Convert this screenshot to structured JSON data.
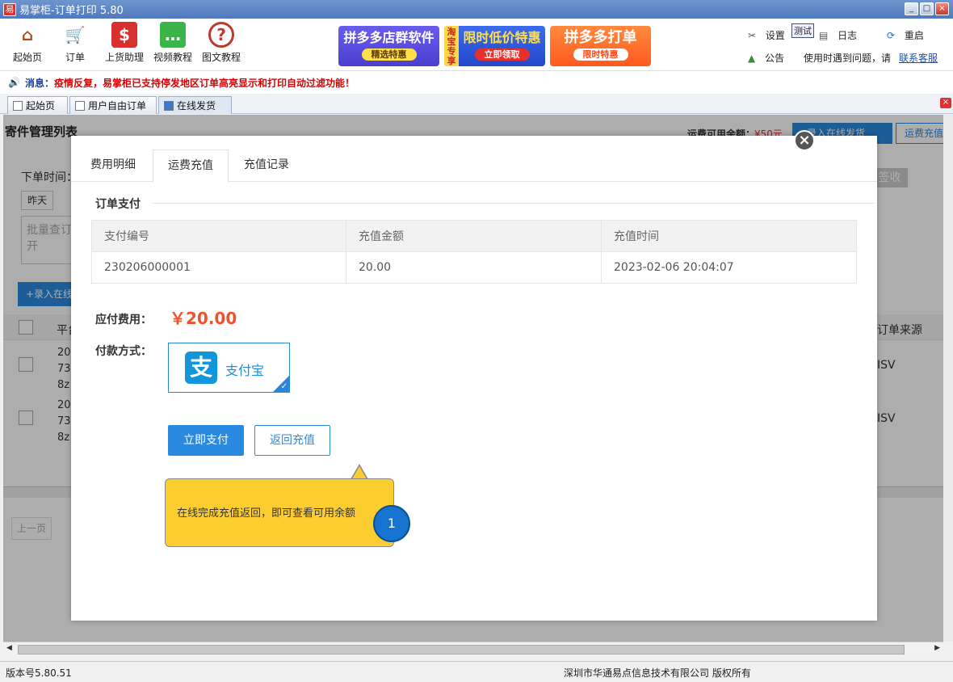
{
  "window": {
    "title": "易掌柜-订单打印 5.80",
    "app_icon": "易"
  },
  "toolbar": {
    "buttons": [
      {
        "label": "起始页",
        "icon": "home-icon"
      },
      {
        "label": "订单",
        "icon": "cart-icon"
      },
      {
        "label": "上货助理",
        "icon": "money-bag-icon"
      },
      {
        "label": "视频教程",
        "icon": "chat-icon"
      },
      {
        "label": "图文教程",
        "icon": "question-icon"
      }
    ],
    "banners": [
      {
        "title": "拼多多店群软件",
        "pill": "精选特惠",
        "color": "#5a4fe0"
      },
      {
        "side": "淘宝专享",
        "title": "限时低价特惠",
        "pill": "立即领取",
        "color": "#2b57e0"
      },
      {
        "title": "拼多多打单",
        "pill": "限时特惠",
        "color": "#ff6a2b"
      }
    ],
    "settings": "设置",
    "test_badge": "测试",
    "log": "日志",
    "restart": "重启",
    "notice": "公告",
    "help_text": "使用时遇到问题，请",
    "contact": "联系客服"
  },
  "message": {
    "prefix": "消息：",
    "text": "疫情反复，易掌柜已支持停发地区订单高亮显示和打印自动过滤功能！"
  },
  "tabs": [
    {
      "label": "起始页"
    },
    {
      "label": "用户自由订单"
    },
    {
      "label": "在线发货"
    }
  ],
  "background": {
    "page_title": "寄件管理列表",
    "balance_label": "运费可用余额：",
    "balance_value": "¥50元",
    "add_button": "+录入在线发货",
    "recharge_button": "运费充值",
    "order_time_label": "下单时间：",
    "yesterday": "昨天",
    "batch_placeholder": "批量查订",
    "batch_more": "开",
    "add_online": "+录入在线",
    "platform_col": "平台",
    "source_col": "订单来源",
    "row1_lines": [
      "20",
      "73",
      "8z"
    ],
    "row2_lines": [
      "20",
      "73",
      "8z"
    ],
    "source_value": "ISV",
    "sign_button": "签收",
    "prev_page": "上一页"
  },
  "modal": {
    "tabs": [
      "费用明细",
      "运费充值",
      "充值记录"
    ],
    "active_tab": 1,
    "section_title": "订单支付",
    "table": {
      "headers": [
        "支付编号",
        "充值金额",
        "充值时间"
      ],
      "rows": [
        [
          "230206000001",
          "20.00",
          "2023-02-06 20:04:07"
        ]
      ]
    },
    "fee_label": "应付费用：",
    "fee_value": "￥20.00",
    "method_label": "付款方式：",
    "method_name": "支付宝",
    "pay_button": "立即支付",
    "back_button": "返回充值",
    "tooltip": "在线完成充值返回，即可查看可用余额",
    "step_number": "1"
  },
  "status": {
    "version": "版本号5.80.51",
    "copyright": "深圳市华通易点信息技术有限公司 版权所有"
  }
}
